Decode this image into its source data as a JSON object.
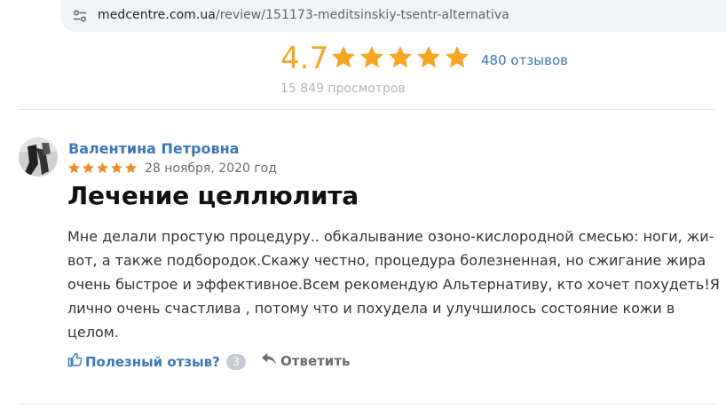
{
  "browser": {
    "url_host": "medcentre.com.ua",
    "url_path": "/review/151173-meditsinskiy-tsentr-alternativa",
    "site_info_icon": "tune-icon"
  },
  "summary": {
    "rating": "4.7",
    "stars_filled": 5,
    "reviews_link": "480 отзывов",
    "views": "15 849 просмотров"
  },
  "review": {
    "author": "Валентина Петровна",
    "stars": 5,
    "date": "28 ноября, 2020 год",
    "title": "Лечение целлюлита",
    "body_lines": [
      "Мне делали простую процедуру.. обкалывание озоно-кислородной смесью: ноги, жи-",
      "вот, а также подбородок.Скажу честно, процедура болезненная, но сжигание жира",
      "очень быстрое и эффективное.Всем рекомендую Альтернативу, кто хочет похудеть!Я",
      "лично очень счастлива , потому что и похудела и улучшилось состояние кожи в",
      "целом."
    ],
    "helpful_label": "Полезный отзыв?",
    "helpful_count": "3",
    "reply_label": "Ответить"
  },
  "colors": {
    "accent": "#3a77b8",
    "star": "#f5a623",
    "small_star": "#f08c28",
    "badge": "#c7cbd1"
  }
}
